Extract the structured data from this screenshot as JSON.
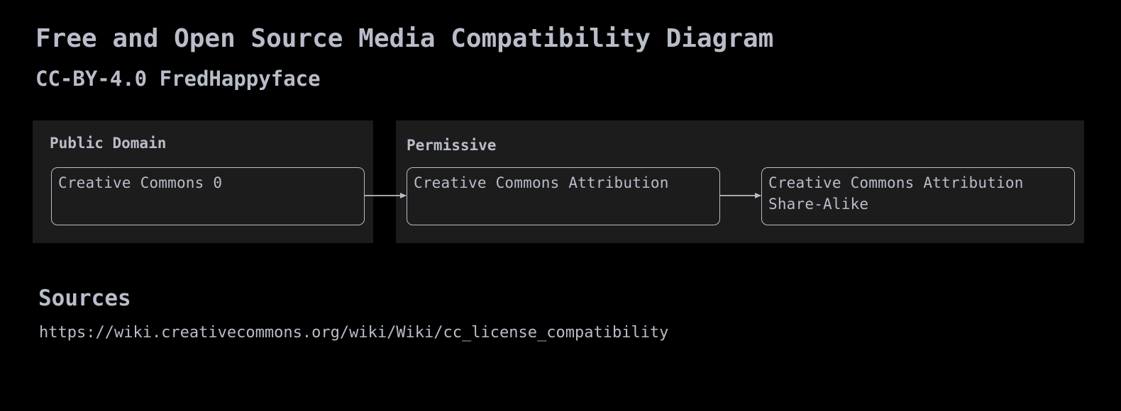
{
  "title": "Free and Open Source Media Compatibility Diagram",
  "subtitle": "CC-BY-4.0 FredHappyface",
  "groups": [
    {
      "label": "Public Domain",
      "nodes": [
        "Creative Commons 0"
      ]
    },
    {
      "label": "Permissive",
      "nodes": [
        "Creative Commons Attribution",
        "Creative Commons Attribution Share-Alike"
      ]
    }
  ],
  "edges": [
    {
      "from": "Creative Commons 0",
      "to": "Creative Commons Attribution"
    },
    {
      "from": "Creative Commons Attribution",
      "to": "Creative Commons Attribution Share-Alike"
    }
  ],
  "sources": {
    "heading": "Sources",
    "link": "https://wiki.creativecommons.org/wiki/Wiki/cc_license_compatibility"
  },
  "colors": {
    "background": "#000000",
    "group_fill": "#1c1c1c",
    "text": "#b9bdc9",
    "stroke": "#b9bdc9"
  }
}
